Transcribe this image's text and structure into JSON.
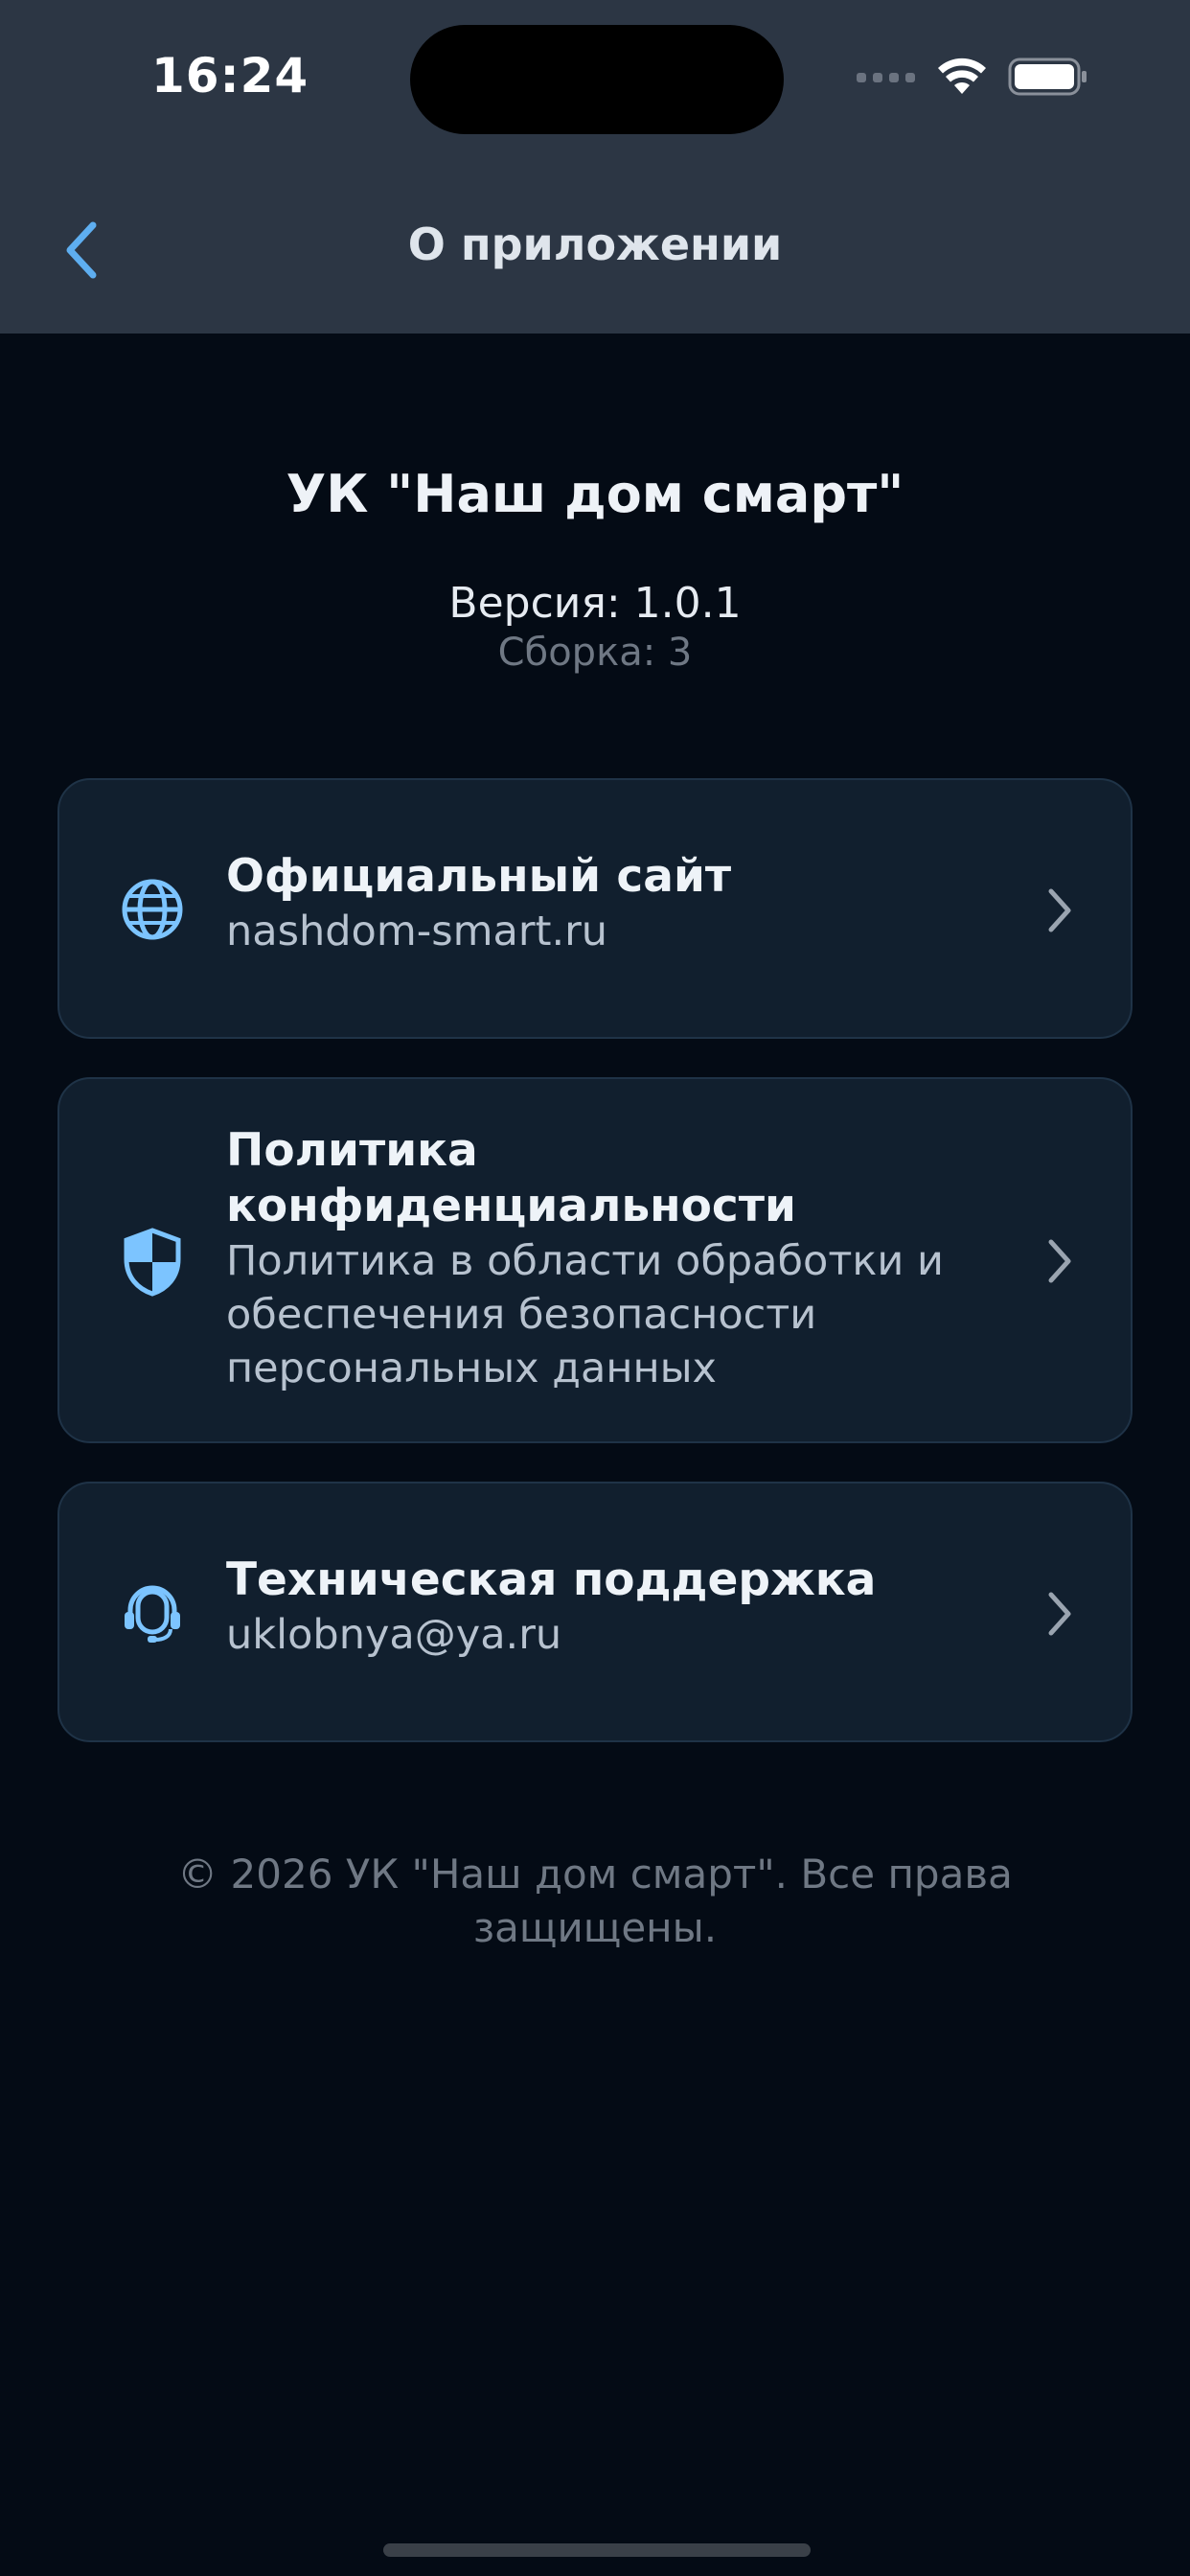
{
  "status_bar": {
    "time": "16:24"
  },
  "header": {
    "title": "О приложении",
    "back_icon": "chevron-left-icon"
  },
  "app_info": {
    "name": "УК \"Наш дом смарт\"",
    "version": "Версия: 1.0.1",
    "build": "Сборка: 3"
  },
  "cards": [
    {
      "icon": "globe-icon",
      "title": "Официальный сайт",
      "subtitle": "nashdom-smart.ru"
    },
    {
      "icon": "shield-icon",
      "title": "Политика конфиденциальности",
      "subtitle": "Политика в области обработки и обеспечения безопасности персональных данных"
    },
    {
      "icon": "headset-icon",
      "title": "Техническая поддержка",
      "subtitle": "uklobnya@ya.ru"
    }
  ],
  "footer": {
    "copyright": "© 2026 УК \"Наш дом смарт\". Все права защищены."
  },
  "colors": {
    "background": "#040b15",
    "header_background": "#2c3644",
    "card_background": "#111f2e",
    "accent": "#7cc4ff"
  }
}
